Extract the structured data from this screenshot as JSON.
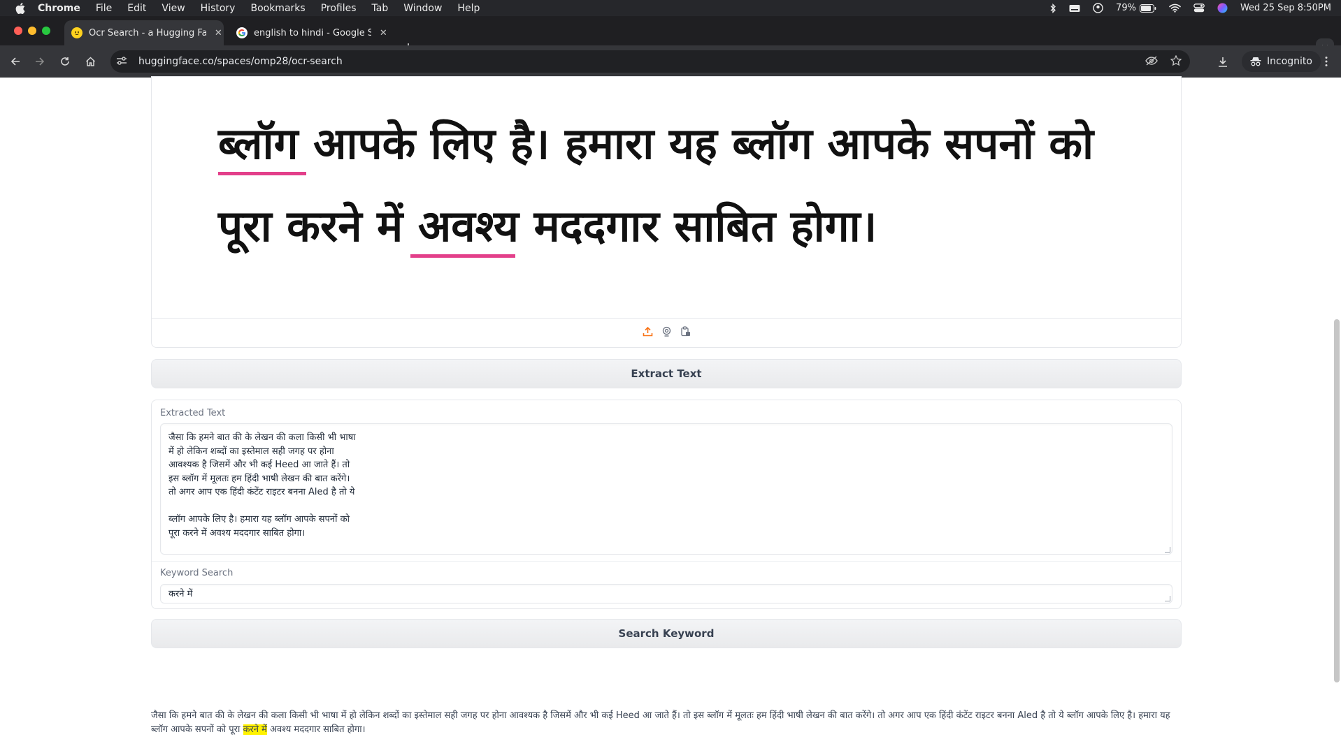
{
  "menubar": {
    "app": "Chrome",
    "items": [
      "File",
      "Edit",
      "View",
      "History",
      "Bookmarks",
      "Profiles",
      "Tab",
      "Window",
      "Help"
    ],
    "battery": "79%",
    "datetime": "Wed 25 Sep  8:50PM"
  },
  "tabs": [
    {
      "title": "Ocr Search - a Hugging Face",
      "favicon": "hugging-face-icon",
      "close": "✕"
    },
    {
      "title": "english to hindi - Google Sear",
      "favicon": "google-icon",
      "close": "✕"
    }
  ],
  "toolbar": {
    "url": "huggingface.co/spaces/omp28/ocr-search",
    "incognito_label": "Incognito"
  },
  "image_panel": {
    "line1": "ब्लॉग आपके लिए है। हमारा यह ब्लॉग आपके सपनों को",
    "line2": "पूरा करने में अवश्य मददगार साबित होगा।"
  },
  "extract_button": {
    "label": "Extract Text"
  },
  "extracted": {
    "label": "Extracted Text",
    "lines": [
      "जैसा कि हमने बात की के लेखन की कला किसी भी भाषा",
      "में हो लेकिन शब्दों का इस्तेमाल सही जगह पर होना",
      "आवश्यक है जिसमें और भी कई Heed आ जाते हैं। तो",
      "इस ब्लॉग में मूलतः हम हिंदी भाषी लेखन की बात करेंगे।",
      "तो अगर आप एक हिंदी कंटेंट राइटर बनना Aled है तो ये",
      "",
      "ब्लॉग आपके लिए है। हमारा यह ब्लॉग आपके सपनों को",
      "पूरा करने में अवश्य मददगार साबित होगा।"
    ]
  },
  "keyword": {
    "label": "Keyword Search",
    "value": "करने में"
  },
  "search_button": {
    "label": "Search Keyword"
  },
  "result": {
    "line1": "जैसा कि हमने बात की के लेखन की कला किसी भी भाषा में हो लेकिन शब्दों का इस्तेमाल सही जगह पर होना आवश्यक है जिसमें और भी कई Heed आ जाते हैं। तो इस ब्लॉग में मूलतः हम हिंदी भाषी लेखन की बात करेंगे। तो अगर आप एक हिंदी कंटेंट राइटर बनना Aled है तो ये ब्लॉग आपके लिए है। हमारा यह",
    "line2_before": "ब्लॉग आपके सपनों को पूरा ",
    "highlight": "करने में",
    "line2_after": " अवश्य मददगार साबित होगा।"
  },
  "colors": {
    "underline": "#e33f8a",
    "highlight": "#fff200",
    "upload_icon": "#f97316"
  }
}
